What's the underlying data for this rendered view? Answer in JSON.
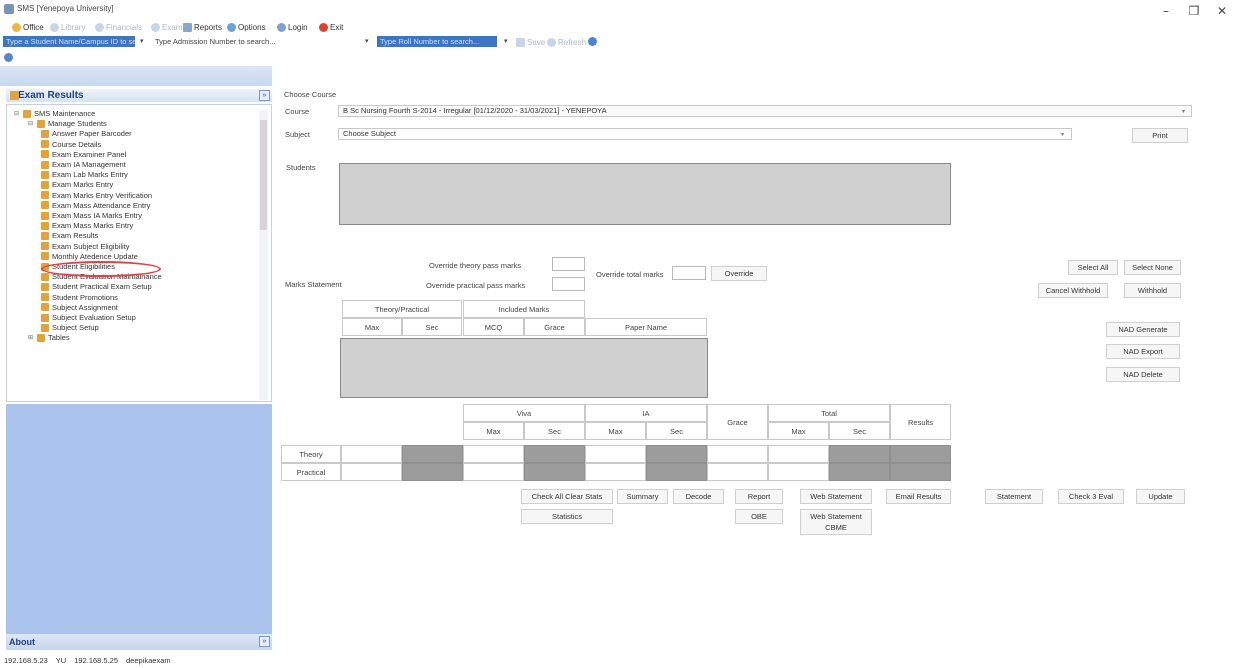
{
  "window": {
    "title": "SMS [Yenepoya University]",
    "controls": [
      "–",
      "❐",
      "✕"
    ]
  },
  "menu": [
    {
      "label": "Office",
      "icon": "office-icon",
      "enabled": true
    },
    {
      "label": "Library",
      "icon": "library-icon",
      "enabled": false
    },
    {
      "label": "Financials",
      "icon": "financials-icon",
      "enabled": false
    },
    {
      "label": "Exam",
      "icon": "exam-icon",
      "enabled": false
    },
    {
      "label": "Reports",
      "icon": "reports-icon",
      "enabled": true
    },
    {
      "label": "Options",
      "icon": "options-icon",
      "enabled": true
    },
    {
      "label": "Login",
      "icon": "login-icon",
      "enabled": true
    },
    {
      "label": "Exit",
      "icon": "exit-icon",
      "enabled": true
    }
  ],
  "search": {
    "student_placeholder": "Type a Student Name/Campus ID to search...",
    "admission_placeholder": "Type Admission Number to search...",
    "roll_placeholder": "Type Roll Number to search...",
    "save_label": "Save",
    "refresh_label": "Refresh"
  },
  "left_panel": {
    "header": "Exam Results",
    "tree": [
      {
        "label": "SMS Maintenance",
        "level": 0,
        "expander": "⊟"
      },
      {
        "label": "Manage Students",
        "level": 1,
        "expander": "⊟"
      },
      {
        "label": "Answer Paper Barcoder",
        "level": 2
      },
      {
        "label": "Course Details",
        "level": 2
      },
      {
        "label": "Exam Examiner Panel",
        "level": 2
      },
      {
        "label": "Exam IA Management",
        "level": 2
      },
      {
        "label": "Exam Lab Marks Entry",
        "level": 2
      },
      {
        "label": "Exam Marks Entry",
        "level": 2
      },
      {
        "label": "Exam Marks Entry Verification",
        "level": 2
      },
      {
        "label": "Exam Mass Attendance Entry",
        "level": 2
      },
      {
        "label": "Exam Mass IA Marks Entry",
        "level": 2
      },
      {
        "label": "Exam Mass Marks Entry",
        "level": 2
      },
      {
        "label": "Exam Results",
        "level": 2
      },
      {
        "label": "Exam Subject Eligibility",
        "level": 2
      },
      {
        "label": "Monthly Atedence Update",
        "level": 2
      },
      {
        "label": "Student Eligibilities",
        "level": 2
      },
      {
        "label": "Student Evaluation Maintainance",
        "level": 2
      },
      {
        "label": "Student Practical Exam Setup",
        "level": 2
      },
      {
        "label": "Student Promotions",
        "level": 2
      },
      {
        "label": "Subject Assignment",
        "level": 2
      },
      {
        "label": "Subject Evaluation Setup",
        "level": 2
      },
      {
        "label": "Subject Setup",
        "level": 2
      },
      {
        "label": "Tables",
        "level": 1,
        "expander": "⊞"
      }
    ],
    "about": "About"
  },
  "status": {
    "ip1": "192.168.5.23",
    "user_code": "YU",
    "ip2": "192.168.5.25",
    "user": "deepikaexam"
  },
  "main": {
    "choose_course_label": "Choose Course",
    "course_label": "Course",
    "course_value": "B Sc Nursing Fourth S-2014 - Irregular [01/12/2020 - 31/03/2021] - YENEPOYA",
    "subject_label": "Subject",
    "subject_value": "Choose Subject",
    "print_label": "Print",
    "students_label": "Students",
    "override_theory_label": "Override theory pass marks",
    "override_practical_label": "Override practical pass marks",
    "override_total_label": "Override total marks",
    "override_button": "Override",
    "select_all": "Select All",
    "select_none": "Select None",
    "cancel_withhold": "Cancel Withhold",
    "withhold": "Withhold",
    "marks_statement_label": "Marks Statement",
    "marks_headers": {
      "theory_practical": "Theory/Practical",
      "included_marks": "Included Marks",
      "max": "Max",
      "sec": "Sec",
      "mcq": "MCQ",
      "grace": "Grace",
      "paper_name": "Paper Name"
    },
    "nad_generate": "NAD Generate",
    "nad_export": "NAD Export",
    "nad_delete": "NAD Delete",
    "results_grid": {
      "viva": "Viva",
      "ia": "IA",
      "grace": "Grace",
      "total": "Total",
      "results": "Results",
      "max": "Max",
      "sec": "Sec",
      "rows": [
        "Theory",
        "Practical"
      ]
    },
    "actions": {
      "check_all_clear_stats": "Check All Clear Stats",
      "summary": "Summary",
      "decode": "Decode",
      "report": "Report",
      "web_statement": "Web Statement",
      "email_results": "Email Results",
      "statement": "Statement",
      "check_3_eval": "Check 3 Eval",
      "update": "Update",
      "statistics": "Statistics",
      "obe": "OBE",
      "web_statement_cbme_1": "Web Statement",
      "web_statement_cbme_2": "CBME"
    }
  },
  "colors": {
    "accent_blue": "#3d74c6",
    "panel_blue": "#a9c3ec",
    "highlight_red": "#e04048",
    "grid_dark": "#9c9c9c"
  }
}
